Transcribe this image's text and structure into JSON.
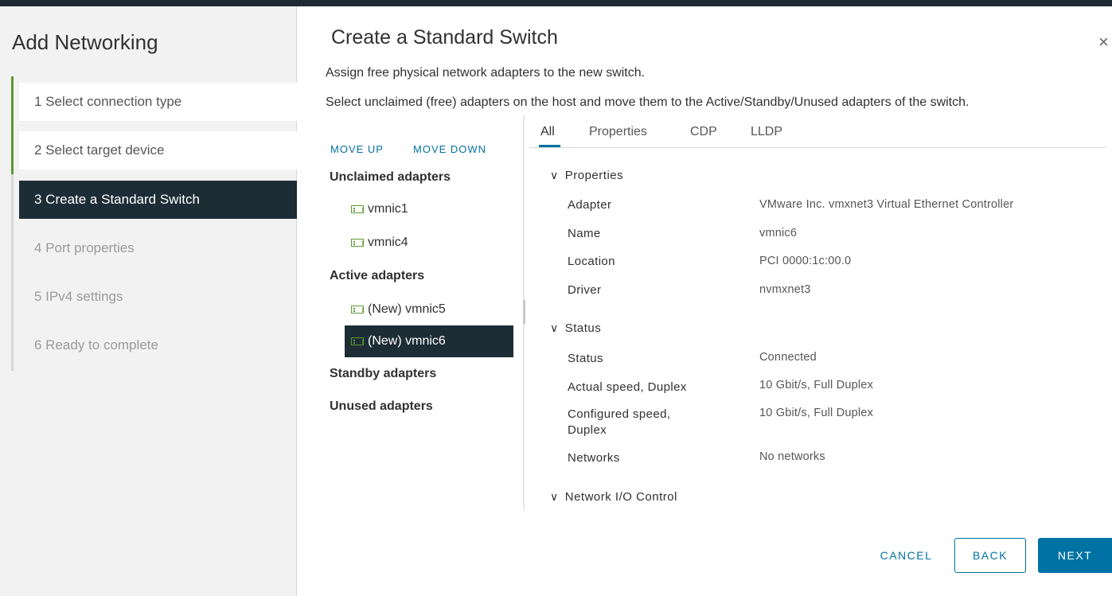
{
  "wizard": {
    "title": "Add Networking",
    "steps": [
      {
        "label": "1  Select connection type",
        "state": "done"
      },
      {
        "label": "2  Select target device",
        "state": "done"
      },
      {
        "label": "3  Create a Standard Switch",
        "state": "current"
      },
      {
        "label": "4  Port properties",
        "state": "future"
      },
      {
        "label": "5  IPv4 settings",
        "state": "future"
      },
      {
        "label": "6  Ready to complete",
        "state": "future"
      }
    ]
  },
  "page": {
    "title": "Create a Standard Switch",
    "close_icon": "×",
    "description1": "Assign free physical network adapters to the new switch.",
    "description2": "Select unclaimed (free) adapters on the host and move them to the Active/Standby/Unused adapters of the switch."
  },
  "adapters": {
    "move_up": "MOVE UP",
    "move_down": "MOVE DOWN",
    "groups": {
      "unclaimed": "Unclaimed adapters",
      "active": "Active adapters",
      "standby": "Standby adapters",
      "unused": "Unused adapters"
    },
    "items": {
      "vmnic1": "vmnic1",
      "vmnic4": "vmnic4",
      "vmnic5": "(New) vmnic5",
      "vmnic6": "(New) vmnic6"
    },
    "selected": "(New) vmnic6"
  },
  "tabs": [
    "All",
    "Properties",
    "CDP",
    "LLDP"
  ],
  "active_tab": "All",
  "details": {
    "properties_section": "Properties",
    "adapter_label": "Adapter",
    "adapter_value": "VMware Inc. vmxnet3 Virtual Ethernet Controller",
    "name_label": "Name",
    "name_value": "vmnic6",
    "location_label": "Location",
    "location_value": "PCI 0000:1c:00.0",
    "driver_label": "Driver",
    "driver_value": "nvmxnet3",
    "status_section": "Status",
    "status_label": "Status",
    "status_value": "Connected",
    "actual_speed_label": "Actual speed, Duplex",
    "actual_speed_value": "10 Gbit/s, Full Duplex",
    "configured_speed_label_line1": "Configured speed,",
    "configured_speed_label_line2": "Duplex",
    "configured_speed_value": "10 Gbit/s, Full Duplex",
    "networks_label": "Networks",
    "networks_value": "No networks",
    "nioc_section": "Network I/O Control",
    "chevron_icon": "∨"
  },
  "footer": {
    "cancel": "CANCEL",
    "back": "BACK",
    "next": "NEXT"
  },
  "colors": {
    "accent": "#0072a3",
    "selected_bg": "#1d2d36",
    "progress_green": "#5b9a32"
  }
}
